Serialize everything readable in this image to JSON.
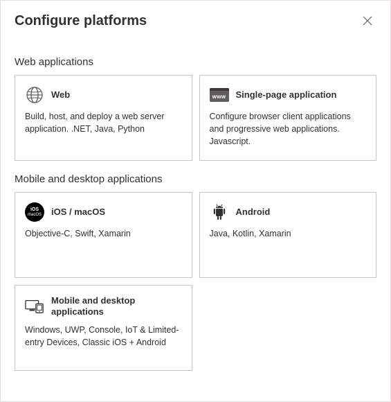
{
  "header": {
    "title": "Configure platforms"
  },
  "sections": {
    "web": {
      "title": "Web applications",
      "cards": {
        "web": {
          "title": "Web",
          "desc": "Build, host, and deploy a web server application. .NET, Java, Python"
        },
        "spa": {
          "title": "Single-page application",
          "desc": "Configure browser client applications and progressive web applications. Javascript.",
          "badge": "www"
        }
      }
    },
    "mobile": {
      "title": "Mobile and desktop applications",
      "cards": {
        "ios": {
          "title": "iOS / macOS",
          "desc": "Objective-C, Swift, Xamarin",
          "iconTop": "iOS",
          "iconBottom": "macOS"
        },
        "android": {
          "title": "Android",
          "desc": "Java, Kotlin, Xamarin"
        },
        "mobiledesktop": {
          "title": "Mobile and desktop applications",
          "desc": "Windows, UWP, Console, IoT & Limited-entry Devices, Classic iOS + Android"
        }
      }
    }
  }
}
